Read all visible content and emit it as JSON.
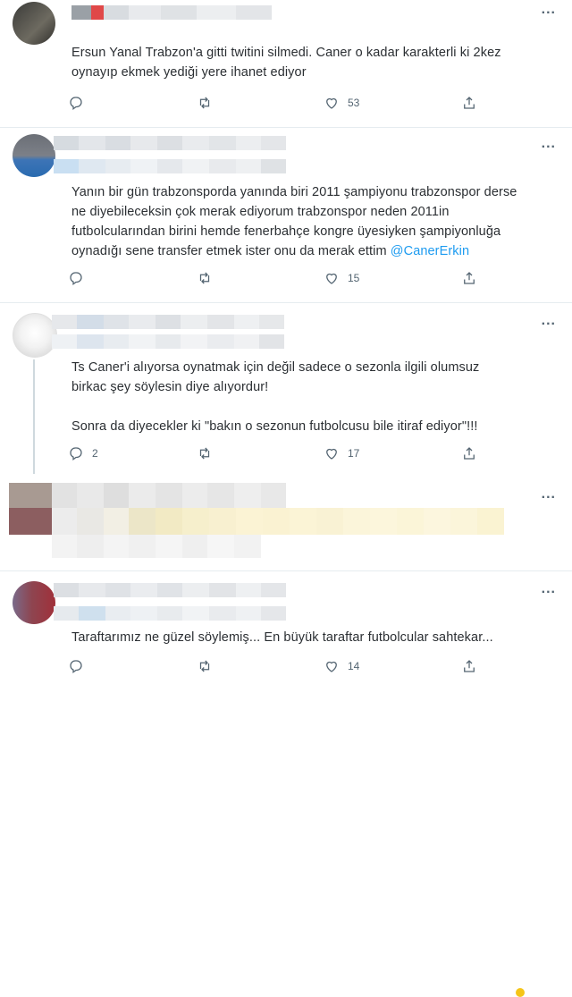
{
  "icons": {
    "more": "more-icon",
    "reply": "reply-icon",
    "retweet": "retweet-icon",
    "like": "like-icon",
    "share": "share-icon"
  },
  "more_label": "...",
  "tweets": [
    {
      "text_lines": [
        "Ersun Yanal Trabzon'a gitti twitini silmedi. Caner o kadar karakterli ki 2kez",
        "oynayıp ekmek yediği yere ihanet ediyor"
      ],
      "reply_count": "",
      "retweet_count": "",
      "like_count": "53"
    },
    {
      "text_lines": [
        "Yanın bir gün trabzonsporda yanında biri 2011 şampiyonu trabzonspor derse",
        "ne diyebileceksin çok merak ediyorum trabzonspor neden 2011in",
        "futbolcularından birini hemde fenerbahçe kongre üyesiyken şampiyonluğa",
        "oynadığı sene transfer etmek ister onu da merak ettim "
      ],
      "mention": "@CanerErkin",
      "reply_count": "",
      "retweet_count": "",
      "like_count": "15"
    },
    {
      "text_lines": [
        "Ts Caner'i alıyorsa oynatmak için değil sadece o sezonla ilgili olumsuz",
        "birkac şey söylesin diye alıyordur!",
        "",
        "Sonra da diyecekler ki \"bakın o sezonun futbolcusu bile itiraf ediyor\"!!!"
      ],
      "reply_count": "2",
      "retweet_count": "",
      "like_count": "17"
    },
    {
      "text_lines": [
        "Taraftarımız ne güzel söylemiş... En büyük taraftar futbolcular sahtekar..."
      ],
      "reply_count": "",
      "retweet_count": "",
      "like_count": "14"
    }
  ]
}
